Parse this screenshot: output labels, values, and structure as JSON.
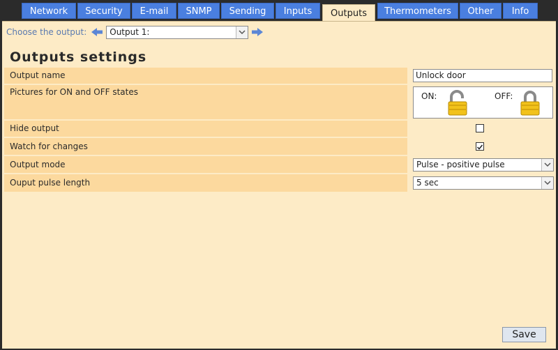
{
  "tabs": [
    {
      "label": "Network"
    },
    {
      "label": "Security"
    },
    {
      "label": "E-mail"
    },
    {
      "label": "SNMP"
    },
    {
      "label": "Sending"
    },
    {
      "label": "Inputs"
    },
    {
      "label": "Outputs",
      "active": true
    },
    {
      "label": "Thermometers"
    },
    {
      "label": "Other"
    },
    {
      "label": "Info"
    }
  ],
  "chooser": {
    "label": "Choose the output:",
    "selected": "Output 1:",
    "prev_icon": "arrow-left-icon",
    "next_icon": "arrow-right-icon"
  },
  "page_title": "Outputs settings",
  "settings": {
    "output_name": {
      "label": "Output name",
      "value": "Unlock door"
    },
    "pictures": {
      "label": "Pictures for ON and OFF states",
      "on_label": "ON:",
      "off_label": "OFF:",
      "on_icon": "unlocked-padlock-icon",
      "off_icon": "locked-padlock-icon"
    },
    "hide_output": {
      "label": "Hide output",
      "checked": false
    },
    "watch_changes": {
      "label": "Watch for changes",
      "checked": true
    },
    "output_mode": {
      "label": "Output mode",
      "value": "Pulse - positive pulse"
    },
    "pulse_length": {
      "label": "Ouput pulse length",
      "value": "5 sec"
    }
  },
  "save_label": "Save",
  "colors": {
    "tab": "#4a7fe0",
    "panel": "#fdebc6",
    "row_label": "#fcd99e",
    "frame": "#2b2b2b"
  }
}
